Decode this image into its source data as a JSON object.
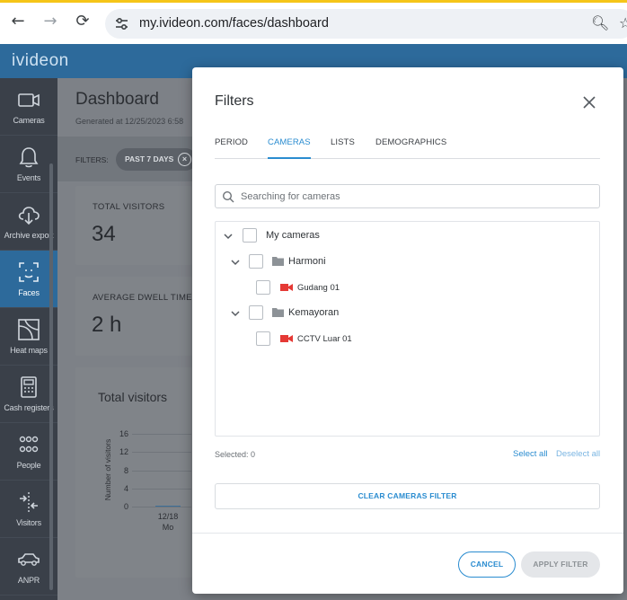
{
  "browser": {
    "url": "my.ivideon.com/faces/dashboard",
    "back_icon": "←",
    "forward_icon": "→",
    "reload_icon": "⟳"
  },
  "app": {
    "logo": "ivideon"
  },
  "sidebar": {
    "items": [
      {
        "label": "Cameras",
        "icon": "camera-icon"
      },
      {
        "label": "Events",
        "icon": "bell-icon"
      },
      {
        "label": "Archive export",
        "icon": "cloud-download-icon"
      },
      {
        "label": "Faces",
        "icon": "face-scan-icon",
        "active": true
      },
      {
        "label": "Heat maps",
        "icon": "heatmap-icon"
      },
      {
        "label": "Cash registers",
        "icon": "cash-register-icon"
      },
      {
        "label": "People",
        "icon": "people-icon"
      },
      {
        "label": "Visitors",
        "icon": "visitors-icon"
      },
      {
        "label": "ANPR",
        "icon": "car-icon"
      }
    ]
  },
  "dashboard": {
    "title": "Dashboard",
    "generated": "Generated at 12/25/2023 6:58",
    "filters_label": "FILTERS:",
    "filter_chip": "PAST 7 DAYS",
    "filter_chip_remove": "×",
    "cards": [
      {
        "label": "TOTAL VISITORS",
        "value": "34"
      },
      {
        "label": "AVERAGE DWELL TIME",
        "value": "2 h"
      }
    ],
    "chart_title": "Total visitors"
  },
  "chart_data": {
    "type": "bar",
    "title": "Total visitors",
    "ylabel": "Number of visitors",
    "yticks": [
      "16",
      "12",
      "8",
      "4",
      "0"
    ],
    "ylim": [
      0,
      16
    ],
    "categories": [
      "12/18"
    ],
    "category_sublabels": [
      "Mo"
    ],
    "values": [
      0
    ]
  },
  "modal": {
    "title": "Filters",
    "close_icon": "close-icon",
    "tabs": [
      {
        "label": "PERIOD",
        "active": false
      },
      {
        "label": "CAMERAS",
        "active": true
      },
      {
        "label": "LISTS",
        "active": false
      },
      {
        "label": "DEMOGRAPHICS",
        "active": false
      }
    ],
    "search_placeholder": "Searching for cameras",
    "tree": {
      "root": "My cameras",
      "groups": [
        {
          "name": "Harmoni",
          "cameras": [
            "Gudang 01"
          ]
        },
        {
          "name": "Kemayoran",
          "cameras": [
            "CCTV Luar 01"
          ]
        }
      ]
    },
    "selected": "Selected: 0",
    "select_all": "Select all",
    "deselect_all": "Deselect all",
    "clear_button": "CLEAR CAMERAS FILTER",
    "cancel_button": "CANCEL",
    "apply_button": "APPLY FILTER"
  },
  "colors": {
    "accent": "#2a8cd0",
    "header": "#2d6a9b",
    "sidebar": "#3a4049",
    "camera_icon": "#e53935"
  }
}
